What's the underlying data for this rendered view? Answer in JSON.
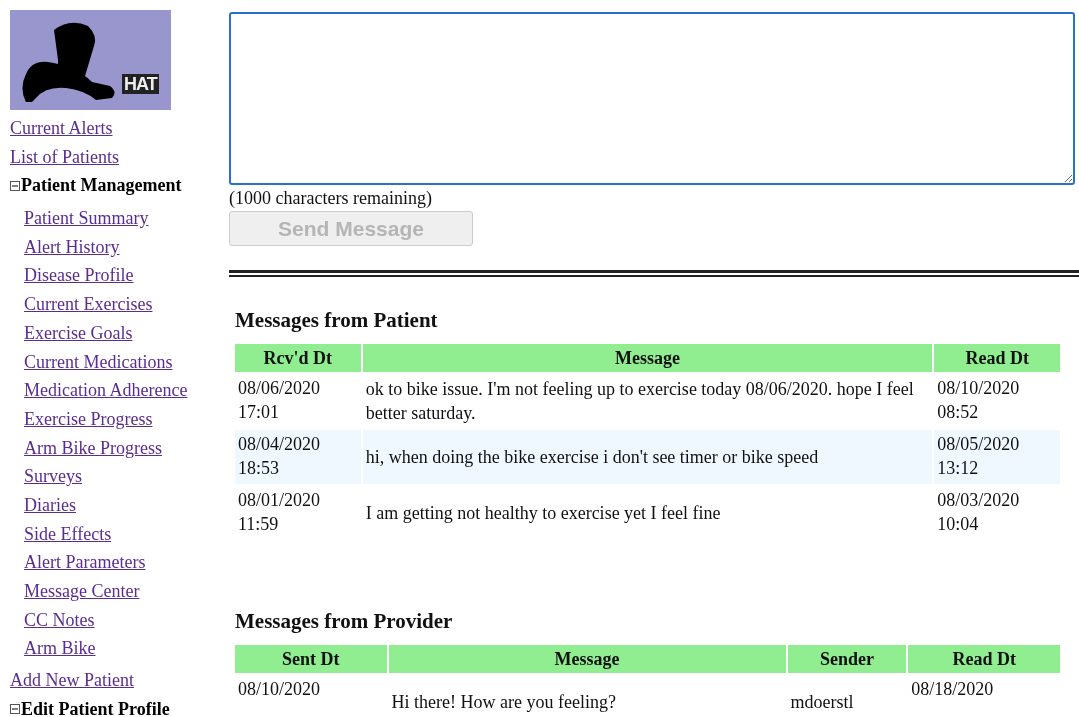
{
  "logo": {
    "text": "HAT"
  },
  "sidebar": {
    "items": [
      {
        "label": "Current Alerts",
        "kind": "link"
      },
      {
        "label": "List of Patients",
        "kind": "link"
      },
      {
        "label": "Patient Management",
        "kind": "section",
        "expanded": true,
        "children": [
          {
            "label": "Patient Summary"
          },
          {
            "label": "Alert History"
          },
          {
            "label": "Disease Profile"
          },
          {
            "label": "Current Exercises"
          },
          {
            "label": "Exercise Goals"
          },
          {
            "label": "Current Medications"
          },
          {
            "label": "Medication Adherence"
          },
          {
            "label": "Exercise Progress"
          },
          {
            "label": "Arm Bike Progress"
          },
          {
            "label": "Surveys"
          },
          {
            "label": "Diaries"
          },
          {
            "label": "Side Effects"
          },
          {
            "label": "Alert Parameters"
          },
          {
            "label": "Message Center"
          },
          {
            "label": "CC Notes"
          },
          {
            "label": "Arm Bike"
          }
        ]
      },
      {
        "label": "Add New Patient",
        "kind": "link"
      },
      {
        "label": "Edit Patient Profile",
        "kind": "section",
        "expanded": true
      }
    ]
  },
  "compose": {
    "remaining": "(1000 characters remaining)",
    "send_button": {
      "label": "Send Message",
      "disabled": true
    }
  },
  "patient_messages": {
    "title": "Messages from Patient",
    "columns": [
      "Rcv'd Dt",
      "Message",
      "Read Dt"
    ],
    "rows": [
      {
        "cells": [
          "08/06/2020 17:01",
          "ok to bike issue. I'm not feeling up to exercise today 08/06/2020. hope I feel better saturday.",
          "08/10/2020 08:52"
        ],
        "highlighted": false
      },
      {
        "cells": [
          "08/04/2020 18:53",
          "hi, when doing the bike exercise i don't see timer or bike speed",
          "08/05/2020 13:12"
        ],
        "highlighted": true
      },
      {
        "cells": [
          "08/01/2020 11:59",
          "I am getting not healthy to  exercise yet I feel fine",
          "08/03/2020 10:04"
        ],
        "highlighted": false
      }
    ]
  },
  "provider_messages": {
    "title": "Messages from Provider",
    "columns": [
      "Sent Dt",
      "Message",
      "Sender",
      "Read Dt"
    ],
    "rows": [
      {
        "cells": [
          "08/10/2020",
          "Hi there! How are you feeling?",
          "mdoerstl",
          "08/18/2020"
        ],
        "highlighted": false
      }
    ]
  }
}
